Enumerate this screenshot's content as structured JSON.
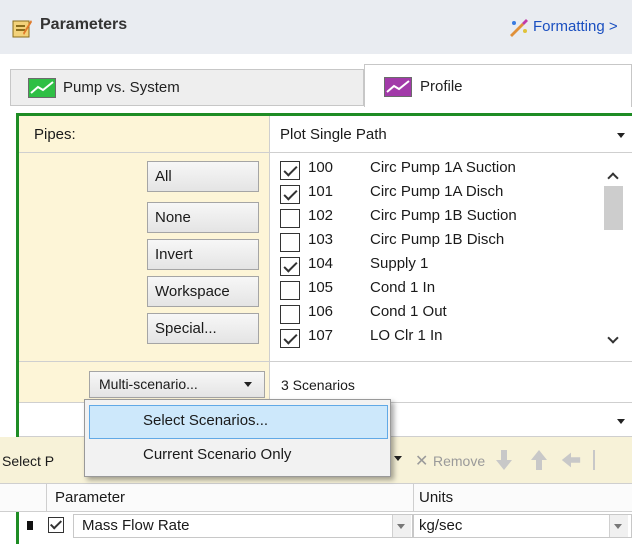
{
  "header": {
    "title": "Parameters",
    "formatting_link": "Formatting >"
  },
  "tabs": [
    {
      "label": "Pump vs. System",
      "selected": false,
      "icon": "graph-green-icon"
    },
    {
      "label": "Profile",
      "selected": true,
      "icon": "graph-purple-icon"
    }
  ],
  "pipes": {
    "label": "Pipes:",
    "plot_mode": "Plot Single Path"
  },
  "selection_buttons": [
    "All",
    "None",
    "Invert",
    "Workspace",
    "Special..."
  ],
  "pipe_list": [
    {
      "num": "100",
      "name": "Circ Pump 1A Suction",
      "checked": true
    },
    {
      "num": "101",
      "name": "Circ Pump 1A Disch",
      "checked": true
    },
    {
      "num": "102",
      "name": "Circ Pump 1B Suction",
      "checked": false
    },
    {
      "num": "103",
      "name": "Circ Pump 1B Disch",
      "checked": false
    },
    {
      "num": "104",
      "name": "Supply 1",
      "checked": true
    },
    {
      "num": "105",
      "name": "Cond 1 In",
      "checked": false
    },
    {
      "num": "106",
      "name": "Cond 1 Out",
      "checked": false
    },
    {
      "num": "107",
      "name": "LO Clr 1 In",
      "checked": true
    }
  ],
  "multi_scenario": {
    "button_label": "Multi-scenario...",
    "count_text": "3 Scenarios"
  },
  "menu": {
    "items": [
      "Select Scenarios...",
      "Current Scenario Only"
    ],
    "highlighted_index": 0
  },
  "toolbar": {
    "select_label": "Select P",
    "remove_label": "Remove"
  },
  "table": {
    "headers": {
      "parameter": "Parameter",
      "units": "Units"
    },
    "rows": [
      {
        "checked": true,
        "parameter": "Mass Flow Rate",
        "units": "kg/sec"
      }
    ]
  },
  "colors": {
    "accent_green": "#1e8c24",
    "panel_yellow": "#fdf5d7",
    "link_blue": "#1a4fc0",
    "menu_highlight": "#cde8fb"
  }
}
